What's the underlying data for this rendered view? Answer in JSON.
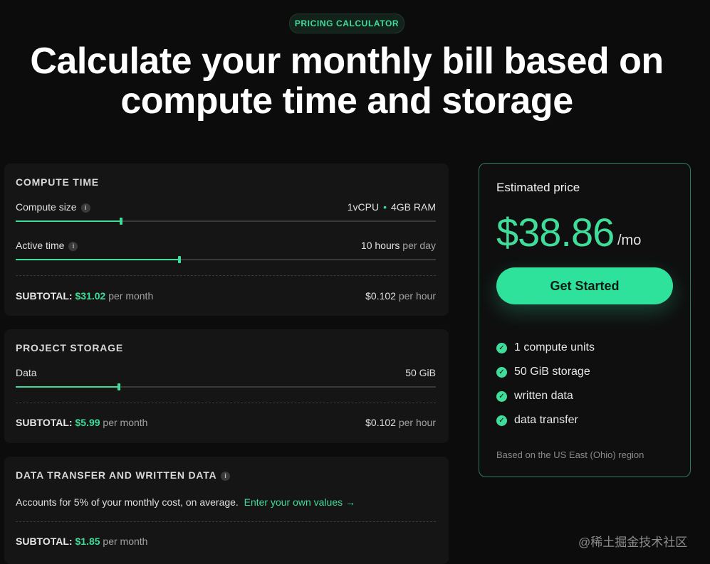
{
  "header": {
    "badge": "PRICING CALCULATOR",
    "title_line1": "Calculate your monthly bill based on",
    "title_line2": "compute time and storage"
  },
  "compute": {
    "title": "COMPUTE TIME",
    "size_label": "Compute size",
    "size_value_cpu": "1vCPU",
    "size_value_ram": "4GB RAM",
    "size_slider_fraction": 0.25,
    "active_label": "Active time",
    "active_value_number": "10 hours",
    "active_value_unit": "per day",
    "active_slider_fraction": 0.39,
    "subtotal_label": "SUBTOTAL:",
    "subtotal_amount": "$31.02",
    "subtotal_period": "per month",
    "hourly_amount": "$0.102",
    "hourly_unit": "per hour"
  },
  "storage": {
    "title": "PROJECT STORAGE",
    "data_label": "Data",
    "data_value": "50 GiB",
    "data_slider_fraction": 0.245,
    "subtotal_label": "SUBTOTAL:",
    "subtotal_amount": "$5.99",
    "subtotal_period": "per month",
    "hourly_amount": "$0.102",
    "hourly_unit": "per hour"
  },
  "transfer": {
    "title": "DATA TRANSFER AND WRITTEN DATA",
    "description": "Accounts for 5% of your monthly cost, on average.",
    "link": "Enter your own values →",
    "subtotal_label": "SUBTOTAL:",
    "subtotal_amount": "$1.85",
    "subtotal_period": "per month"
  },
  "estimate": {
    "title": "Estimated price",
    "amount": "$38.86",
    "unit": "/mo",
    "cta": "Get Started",
    "features": [
      "1 compute units",
      "50 GiB storage",
      "written data",
      "data transfer"
    ],
    "region_note": "Based on the US East (Ohio) region"
  },
  "watermark": "@稀土掘金技术社区",
  "colors": {
    "accent": "#3fdc9a",
    "background": "#0c0c0c",
    "card": "#151516"
  },
  "icons": {
    "info": "info-icon",
    "check": "check-circle-icon"
  }
}
